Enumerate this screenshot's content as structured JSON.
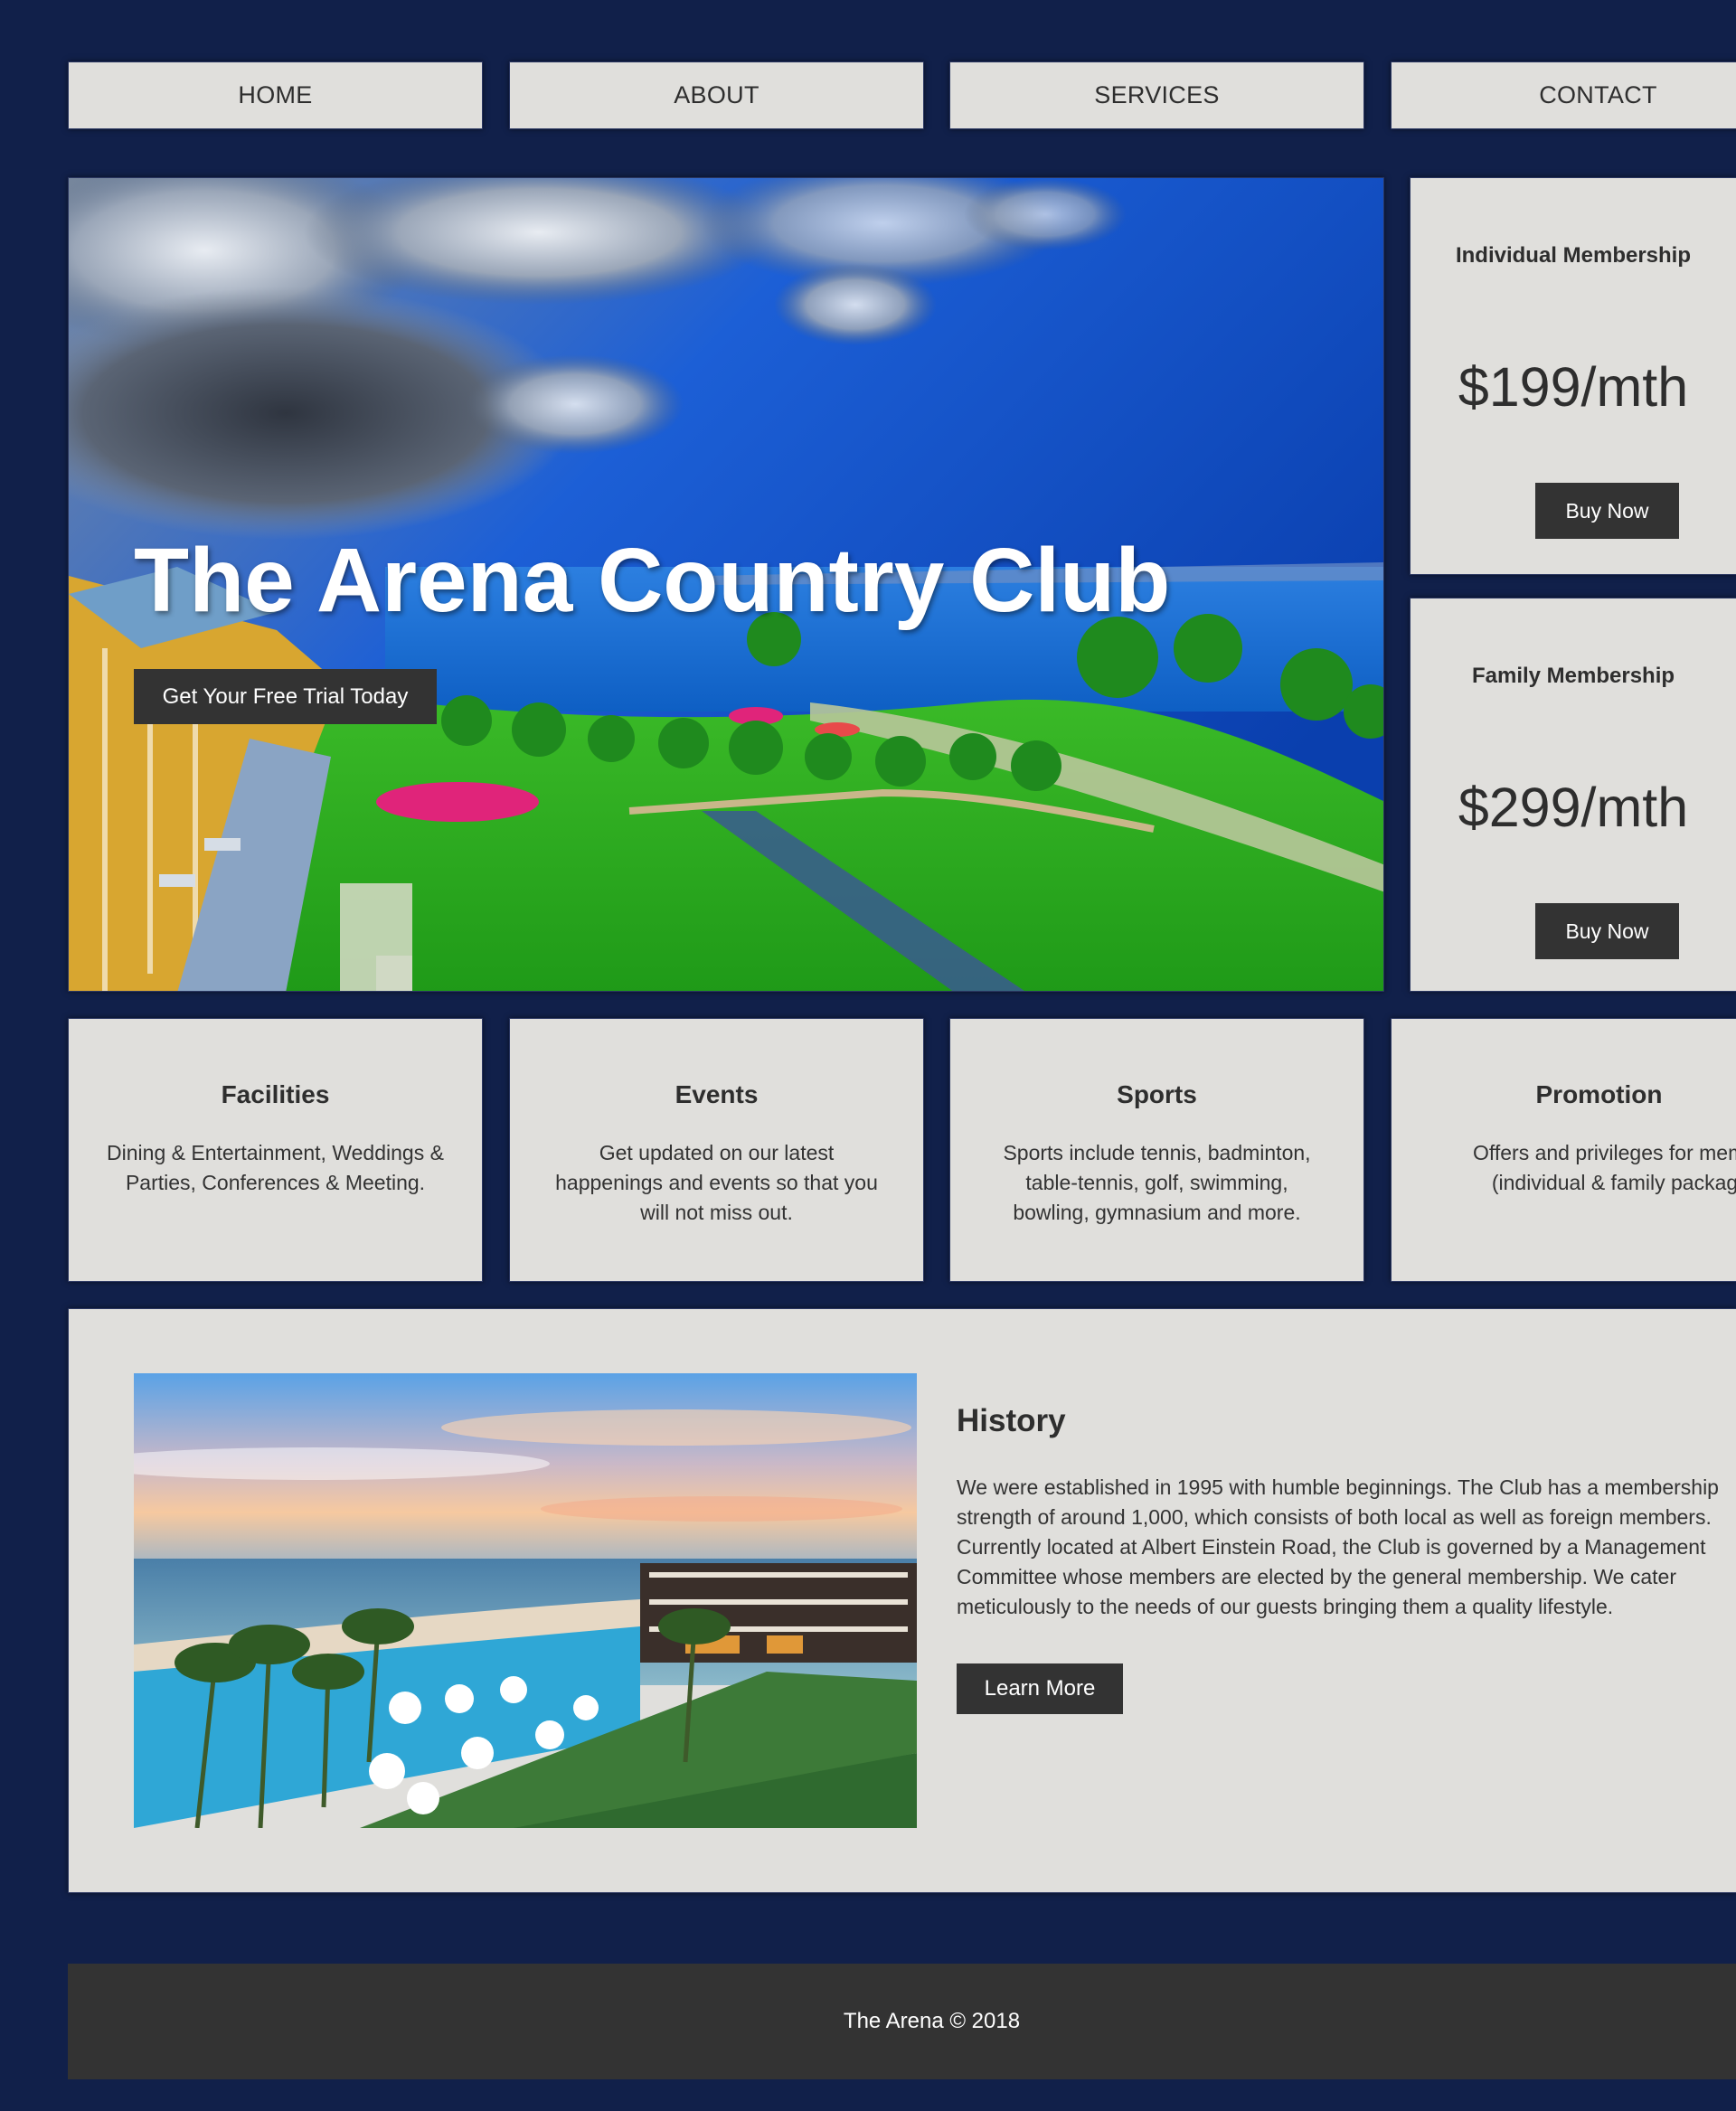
{
  "nav": {
    "items": [
      {
        "label": "HOME"
      },
      {
        "label": "ABOUT"
      },
      {
        "label": "SERVICES"
      },
      {
        "label": "CONTACT"
      }
    ]
  },
  "hero": {
    "title": "The Arena Country Club",
    "cta_label": "Get Your Free Trial Today"
  },
  "pricing": [
    {
      "name": "Individual Membership",
      "price": "$199/mth",
      "button": "Buy Now"
    },
    {
      "name": "Family Membership",
      "price": "$299/mth",
      "button": "Buy Now"
    }
  ],
  "features": [
    {
      "title": "Facilities",
      "text": "Dining & Entertainment, Weddings & Parties, Conferences & Meeting."
    },
    {
      "title": "Events",
      "text": "Get updated on our latest happenings and events so that you will not miss out."
    },
    {
      "title": "Sports",
      "text": "Sports include tennis, badminton, table-tennis, golf, swimming, bowling, gymnasium and more."
    },
    {
      "title": "Promotion",
      "text": "Offers and privileges for members (individual & family packages)"
    }
  ],
  "history": {
    "title": "History",
    "text": "We were established in 1995 with humble beginnings. The Club has a membership strength of around 1,000, which consists of both local as well as foreign members. Currently located at Albert Einstein Road, the Club is governed by a Management Committee whose members are elected by the general membership. We cater meticulously to the needs of our guests bringing them a quality lifestyle.",
    "button": "Learn More"
  },
  "footer": {
    "text": "The Arena © 2018"
  },
  "colors": {
    "page_background": "#11204a",
    "panel_background": "#e0dfdc",
    "button_background": "#333333",
    "footer_background": "#333333"
  }
}
